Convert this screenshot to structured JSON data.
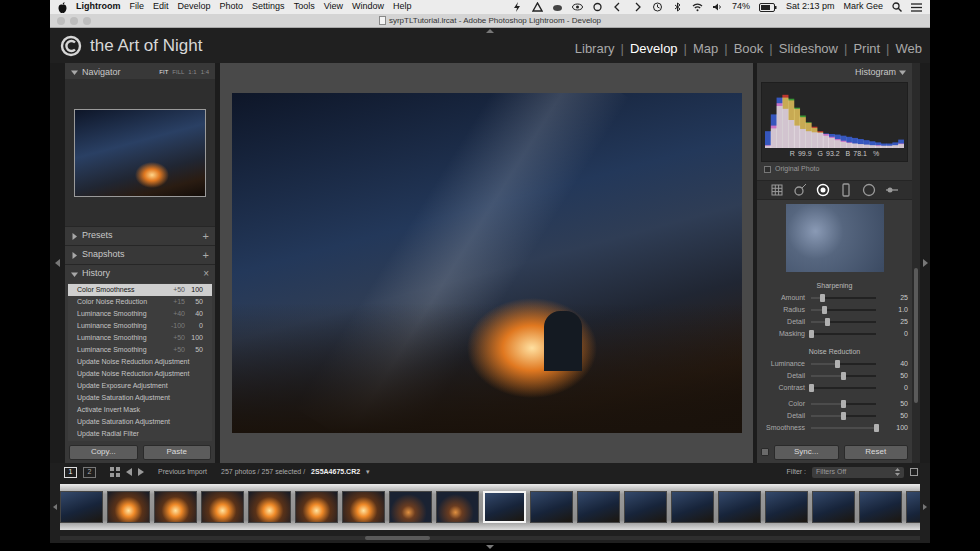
{
  "menubar": {
    "app": "Lightroom",
    "menus": [
      "File",
      "Edit",
      "Develop",
      "Photo",
      "Settings",
      "Tools",
      "View",
      "Window",
      "Help"
    ],
    "battery": "74%",
    "clock": "Sat 2:13 pm",
    "user": "Mark Gee"
  },
  "window": {
    "title": "syrpTLTutorial.lrcat - Adobe Photoshop Lightroom - Develop"
  },
  "identity_plate": {
    "text": "the Art of Night"
  },
  "modules": {
    "separator": "|",
    "items": [
      {
        "label": "Library",
        "selected": false
      },
      {
        "label": "Develop",
        "selected": true
      },
      {
        "label": "Map",
        "selected": false
      },
      {
        "label": "Book",
        "selected": false
      },
      {
        "label": "Slideshow",
        "selected": false
      },
      {
        "label": "Print",
        "selected": false
      },
      {
        "label": "Web",
        "selected": false
      }
    ]
  },
  "left_panel": {
    "navigator": {
      "title": "Navigator",
      "expanded": true,
      "zoom": [
        {
          "label": "FIT",
          "selected": true
        },
        {
          "label": "FILL",
          "selected": false
        },
        {
          "label": "1:1",
          "selected": false
        },
        {
          "label": "1:4",
          "selected": false
        }
      ]
    },
    "sections": [
      {
        "title": "Presets",
        "expanded": false,
        "action": "+"
      },
      {
        "title": "Snapshots",
        "expanded": false,
        "action": "+"
      }
    ],
    "history": {
      "title": "History",
      "expanded": true,
      "action": "×",
      "items": [
        {
          "label": "Color Smoothness",
          "delta": "+50",
          "value": "100",
          "selected": true
        },
        {
          "label": "Color Noise Reduction",
          "delta": "+15",
          "value": "50",
          "selected": false
        },
        {
          "label": "Luminance Smoothing",
          "delta": "+40",
          "value": "40",
          "selected": false
        },
        {
          "label": "Luminance Smoothing",
          "delta": "-100",
          "value": "0",
          "selected": false
        },
        {
          "label": "Luminance Smoothing",
          "delta": "+50",
          "value": "100",
          "selected": false
        },
        {
          "label": "Luminance Smoothing",
          "delta": "+50",
          "value": "50",
          "selected": false
        },
        {
          "label": "Update Noise Reduction Adjustment",
          "selected": false
        },
        {
          "label": "Update Noise Reduction Adjustment",
          "selected": false
        },
        {
          "label": "Update Exposure Adjustment",
          "selected": false
        },
        {
          "label": "Update Saturation Adjustment",
          "selected": false
        },
        {
          "label": "Activate Invert Mask",
          "selected": false
        },
        {
          "label": "Update Saturation Adjustment",
          "selected": false
        },
        {
          "label": "Update Radial Filter",
          "selected": false
        }
      ]
    },
    "buttons": [
      "Copy...",
      "Paste"
    ]
  },
  "right_panel": {
    "histogram": {
      "title": "Histogram",
      "expanded": true,
      "series": [
        {
          "name": "red",
          "color": "#d83a30",
          "values": [
            5,
            40,
            80,
            95,
            85,
            70,
            55,
            45,
            38,
            30,
            25,
            20,
            16,
            13,
            10,
            8,
            7,
            6,
            5,
            5,
            4,
            4,
            5,
            8
          ]
        },
        {
          "name": "green",
          "color": "#3fae3a",
          "values": [
            4,
            35,
            75,
            90,
            88,
            72,
            58,
            46,
            36,
            28,
            22,
            18,
            14,
            11,
            9,
            8,
            7,
            6,
            5,
            4,
            4,
            4,
            5,
            7
          ]
        },
        {
          "name": "blue",
          "color": "#3a5fd8",
          "values": [
            30,
            60,
            90,
            70,
            50,
            40,
            34,
            30,
            28,
            27,
            26,
            25,
            24,
            22,
            20,
            18,
            16,
            14,
            12,
            10,
            8,
            8,
            10,
            15
          ]
        }
      ],
      "readout": [
        {
          "label": "R",
          "value": "99.9"
        },
        {
          "label": "G",
          "value": "93.2"
        },
        {
          "label": "B",
          "value": "78.1"
        }
      ],
      "unit": "%"
    },
    "original_photo": {
      "label": "Original Photo",
      "checked": false
    },
    "tools": [
      {
        "kind": "crop",
        "selected": false
      },
      {
        "kind": "spot",
        "selected": false
      },
      {
        "kind": "redeye",
        "selected": true
      },
      {
        "kind": "graduated",
        "selected": false
      },
      {
        "kind": "radial",
        "selected": false
      },
      {
        "kind": "brush",
        "selected": false
      }
    ],
    "sections": [
      {
        "title": "Sharpening",
        "groups": [
          [
            {
              "label": "Amount",
              "value": "25",
              "level": 0.17
            },
            {
              "label": "Radius",
              "value": "1.0",
              "level": 0.2
            },
            {
              "label": "Detail",
              "value": "25",
              "level": 0.25
            },
            {
              "label": "Masking",
              "value": "0",
              "level": 0
            }
          ]
        ]
      },
      {
        "title": "Noise Reduction",
        "groups": [
          [
            {
              "label": "Luminance",
              "value": "40",
              "level": 0.4
            },
            {
              "label": "Detail",
              "value": "50",
              "level": 0.5
            },
            {
              "label": "Contrast",
              "value": "0",
              "level": 0
            }
          ],
          [
            {
              "label": "Color",
              "value": "50",
              "level": 0.5
            },
            {
              "label": "Detail",
              "value": "50",
              "level": 0.5
            },
            {
              "label": "Smoothness",
              "value": "100",
              "level": 1
            }
          ]
        ]
      }
    ],
    "buttons": [
      "Sync...",
      "Reset"
    ]
  },
  "filmstrip": {
    "views": [
      {
        "label": "1",
        "selected": true
      },
      {
        "label": "2",
        "selected": false
      }
    ],
    "source": "Previous Import",
    "count": "257 photos / 257 selected /",
    "file": "2S5A4675.CR2",
    "file_menu": "▾",
    "filter_label": "Filter :",
    "filter_value": "Filters Off",
    "thumbnails": [
      {
        "kind": "night",
        "selected": false
      },
      {
        "kind": "fire",
        "selected": false
      },
      {
        "kind": "fire",
        "selected": false
      },
      {
        "kind": "fire",
        "selected": false
      },
      {
        "kind": "fire",
        "selected": false
      },
      {
        "kind": "fire",
        "selected": false
      },
      {
        "kind": "fire",
        "selected": false
      },
      {
        "kind": "glow",
        "selected": false
      },
      {
        "kind": "glow",
        "selected": false
      },
      {
        "kind": "night",
        "selected": true
      },
      {
        "kind": "night",
        "selected": false
      },
      {
        "kind": "night",
        "selected": false
      },
      {
        "kind": "night",
        "selected": false
      },
      {
        "kind": "night",
        "selected": false
      },
      {
        "kind": "night",
        "selected": false
      },
      {
        "kind": "night",
        "selected": false
      },
      {
        "kind": "night",
        "selected": false
      },
      {
        "kind": "night",
        "selected": false
      },
      {
        "kind": "night",
        "selected": false
      }
    ]
  }
}
